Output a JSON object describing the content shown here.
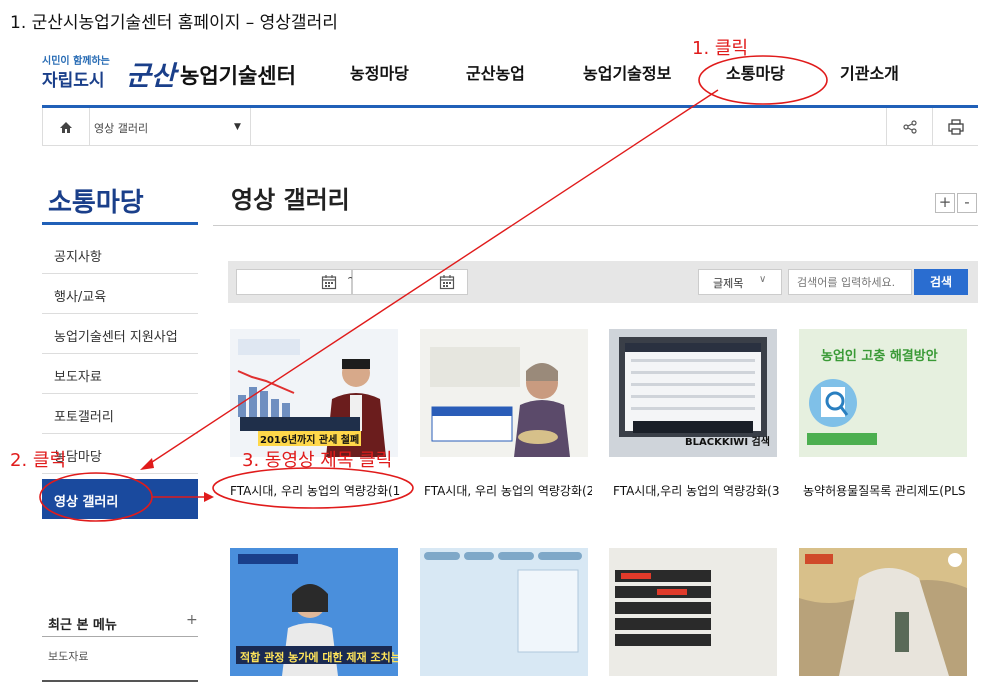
{
  "caption": "1. 군산시농업기술센터 홈페이지 – 영상갤러리",
  "logo": {
    "slogan_top": "시민이 함께하는",
    "slogan_main": "자립도시",
    "city": "군산",
    "org": "농업기술센터"
  },
  "gnb": [
    {
      "label": "농정마당"
    },
    {
      "label": "군산농업"
    },
    {
      "label": "농업기술정보"
    },
    {
      "label": "소통마당"
    },
    {
      "label": "기관소개"
    }
  ],
  "breadcrumb": {
    "current": "영상 갤러리"
  },
  "sidebar": {
    "title": "소통마당",
    "items": [
      {
        "label": "공지사항"
      },
      {
        "label": "행사/교육"
      },
      {
        "label": "농업기술센터 지원사업"
      },
      {
        "label": "보도자료"
      },
      {
        "label": "포토갤러리"
      },
      {
        "label": "농담마당"
      },
      {
        "label": "영상 갤러리"
      }
    ],
    "recent_title": "최근 본 메뉴",
    "recent_plus": "+",
    "recent_items": [
      "보도자료"
    ]
  },
  "content": {
    "title": "영상 갤러리",
    "zoom_in": "+",
    "zoom_out": "-",
    "date_sep": "~",
    "select_label": "글제목",
    "search_placeholder": "검색어를 입력하세요.",
    "search_button": "검색"
  },
  "videos_row1": [
    {
      "caption": "FTA시대, 우리 농업의 역량강화(1",
      "thumb_text": "2016년까지 관세 철폐"
    },
    {
      "caption": "FTA시대, 우리 농업의 역량강화(2",
      "thumb_text": ""
    },
    {
      "caption": "FTA시대,우리 농업의 역량강화(3",
      "thumb_text": "BLACKKIWI 검색"
    },
    {
      "caption": "농약허용물질목록 관리제도(PLS",
      "thumb_text": "농업인 고충 해결방안"
    }
  ],
  "videos_row2": [
    {
      "thumb_text": "적합 관정 농가에 대한 제재 조치는"
    },
    {
      "thumb_text": ""
    },
    {
      "thumb_text": ""
    },
    {
      "thumb_text": ""
    }
  ],
  "annotations": {
    "a1": "1. 클릭",
    "a2": "2. 클릭",
    "a3": "3. 동영상 제목 클릭"
  },
  "colors": {
    "brand_blue": "#1a4a9e",
    "accent_line": "#2060b8",
    "annotation_red": "#e01b1b",
    "search_button": "#2a6dd0"
  }
}
